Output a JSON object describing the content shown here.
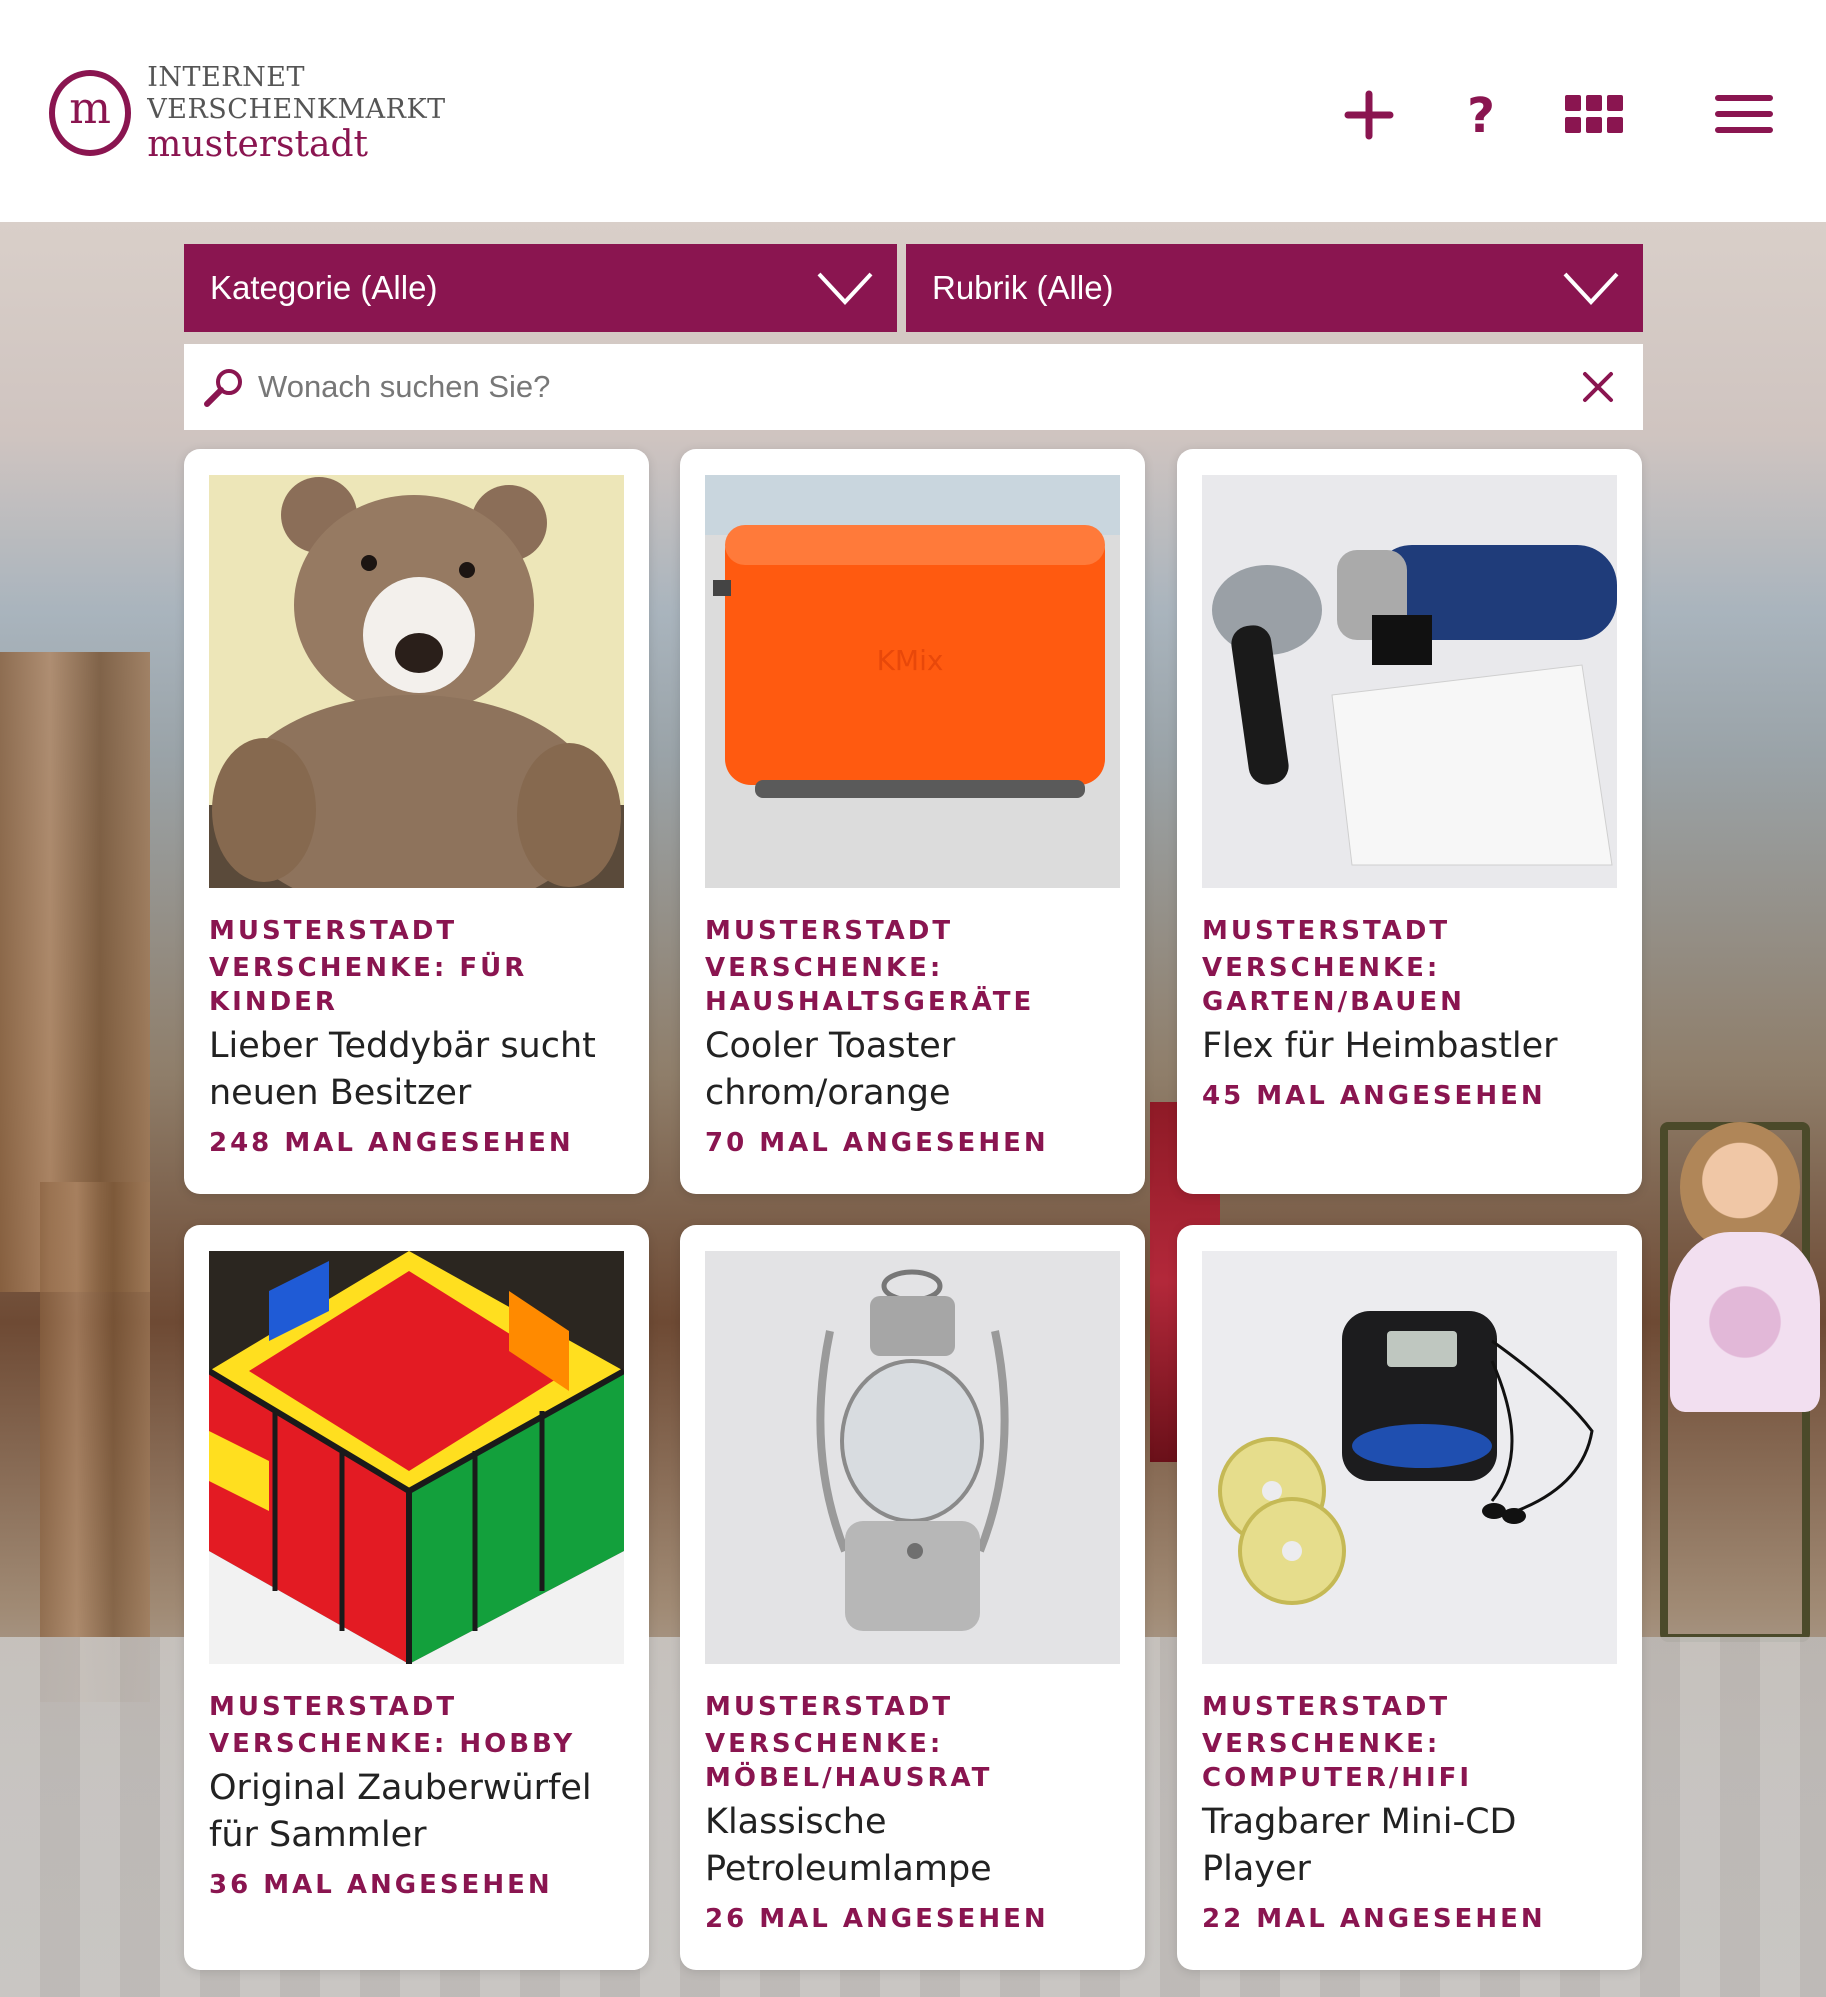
{
  "header": {
    "logo_letter": "m",
    "logo_top": "INTERNET VERSCHENKMARKT",
    "logo_bottom": "musterstadt"
  },
  "icons": {
    "add": "plus-icon",
    "help": "question-icon",
    "apps": "grid-icon",
    "menu": "hamburger-icon"
  },
  "filters": {
    "kategorie": "Kategorie (Alle)",
    "rubrik": "Rubrik (Alle)",
    "search_placeholder": "Wonach suchen Sie?"
  },
  "colors": {
    "accent": "#8a1550"
  },
  "cards": [
    {
      "location": "MUSTERSTADT",
      "category": "VERSCHENKE: FÜR KINDER",
      "title": "Lieber Teddybär sucht neuen Besitzer",
      "views": "248 MAL ANGESEHEN",
      "image": "teddy-bear"
    },
    {
      "location": "MUSTERSTADT",
      "category": "VERSCHENKE: HAUSHALTSGERÄTE",
      "title": "Cooler Toaster chrom/orange",
      "views": "70 MAL ANGESEHEN",
      "image": "toaster"
    },
    {
      "location": "MUSTERSTADT",
      "category": "VERSCHENKE: GARTEN/BAUEN",
      "title": "Flex für Heimbastler",
      "views": "45 MAL ANGESEHEN",
      "image": "angle-grinder"
    },
    {
      "location": "MUSTERSTADT",
      "category": "VERSCHENKE: HOBBY",
      "title": "Original Zauberwürfel für Sammler",
      "views": "36 MAL ANGESEHEN",
      "image": "rubiks-cube"
    },
    {
      "location": "MUSTERSTADT",
      "category": "VERSCHENKE: MÖBEL/HAUSRAT",
      "title": "Klassische Petroleumlampe",
      "views": "26 MAL ANGESEHEN",
      "image": "oil-lamp"
    },
    {
      "location": "MUSTERSTADT",
      "category": "VERSCHENKE: COMPUTER/HIFI",
      "title": "Tragbarer Mini-CD Player",
      "views": "22 MAL ANGESEHEN",
      "image": "cd-player"
    }
  ]
}
